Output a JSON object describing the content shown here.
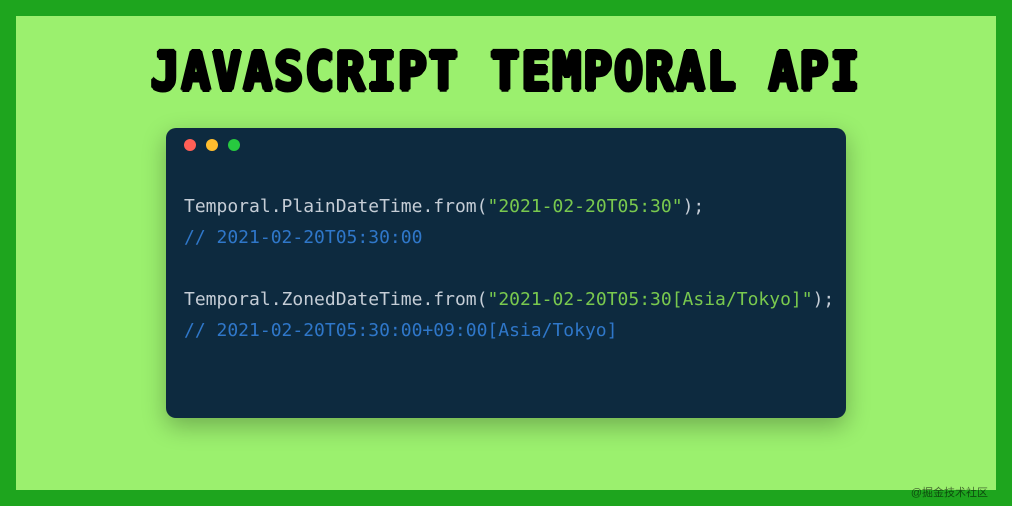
{
  "title": "JAVASCRIPT TEMPORAL API",
  "code": {
    "line1": {
      "obj": "Temporal",
      "dot1": ".",
      "type": "PlainDateTime",
      "dot2": ".",
      "method": "from",
      "open": "(",
      "str": "\"2021-02-20T05:30\"",
      "close": ");"
    },
    "comment1": "// 2021-02-20T05:30:00",
    "blank": "",
    "line2": {
      "obj": "Temporal",
      "dot1": ".",
      "type": "ZonedDateTime",
      "dot2": ".",
      "method": "from",
      "open": "(",
      "str": "\"2021-02-20T05:30[Asia/Tokyo]\"",
      "close": ");"
    },
    "comment2": "// 2021-02-20T05:30:00+09:00[Asia/Tokyo]"
  },
  "watermark": "@掘金技术社区"
}
